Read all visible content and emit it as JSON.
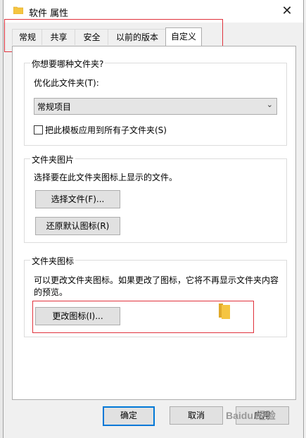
{
  "window": {
    "title": "软件 属性",
    "close_glyph": "✕"
  },
  "tabs": [
    {
      "label": "常规"
    },
    {
      "label": "共享"
    },
    {
      "label": "安全"
    },
    {
      "label": "以前的版本"
    },
    {
      "label": "自定义",
      "active": true
    }
  ],
  "optimize_group": {
    "title": "你想要哪种文件夹?",
    "optimize_label": "优化此文件夹(T):",
    "select_value": "常规项目",
    "checkbox_label": "把此模板应用到所有子文件夹(S)",
    "checkbox_checked": false
  },
  "picture_group": {
    "title": "文件夹图片",
    "description": "选择要在此文件夹图标上显示的文件。",
    "choose_file_button": "选择文件(F)...",
    "restore_default_button": "还原默认图标(R)"
  },
  "icon_group": {
    "title": "文件夹图标",
    "description_line1": "可以更改文件夹图标。如果更改了图标，它将不再显示文件夹内容",
    "description_line2": "的预览。",
    "change_icon_button": "更改图标(I)..."
  },
  "footer": {
    "ok_button": "确定",
    "cancel_button": "取消",
    "apply_button": "应用"
  },
  "watermark": "Baidu 经验",
  "colors": {
    "highlight_box": "#e0323c",
    "folder": "#f5c542",
    "default_button_border": "#0078d7"
  }
}
